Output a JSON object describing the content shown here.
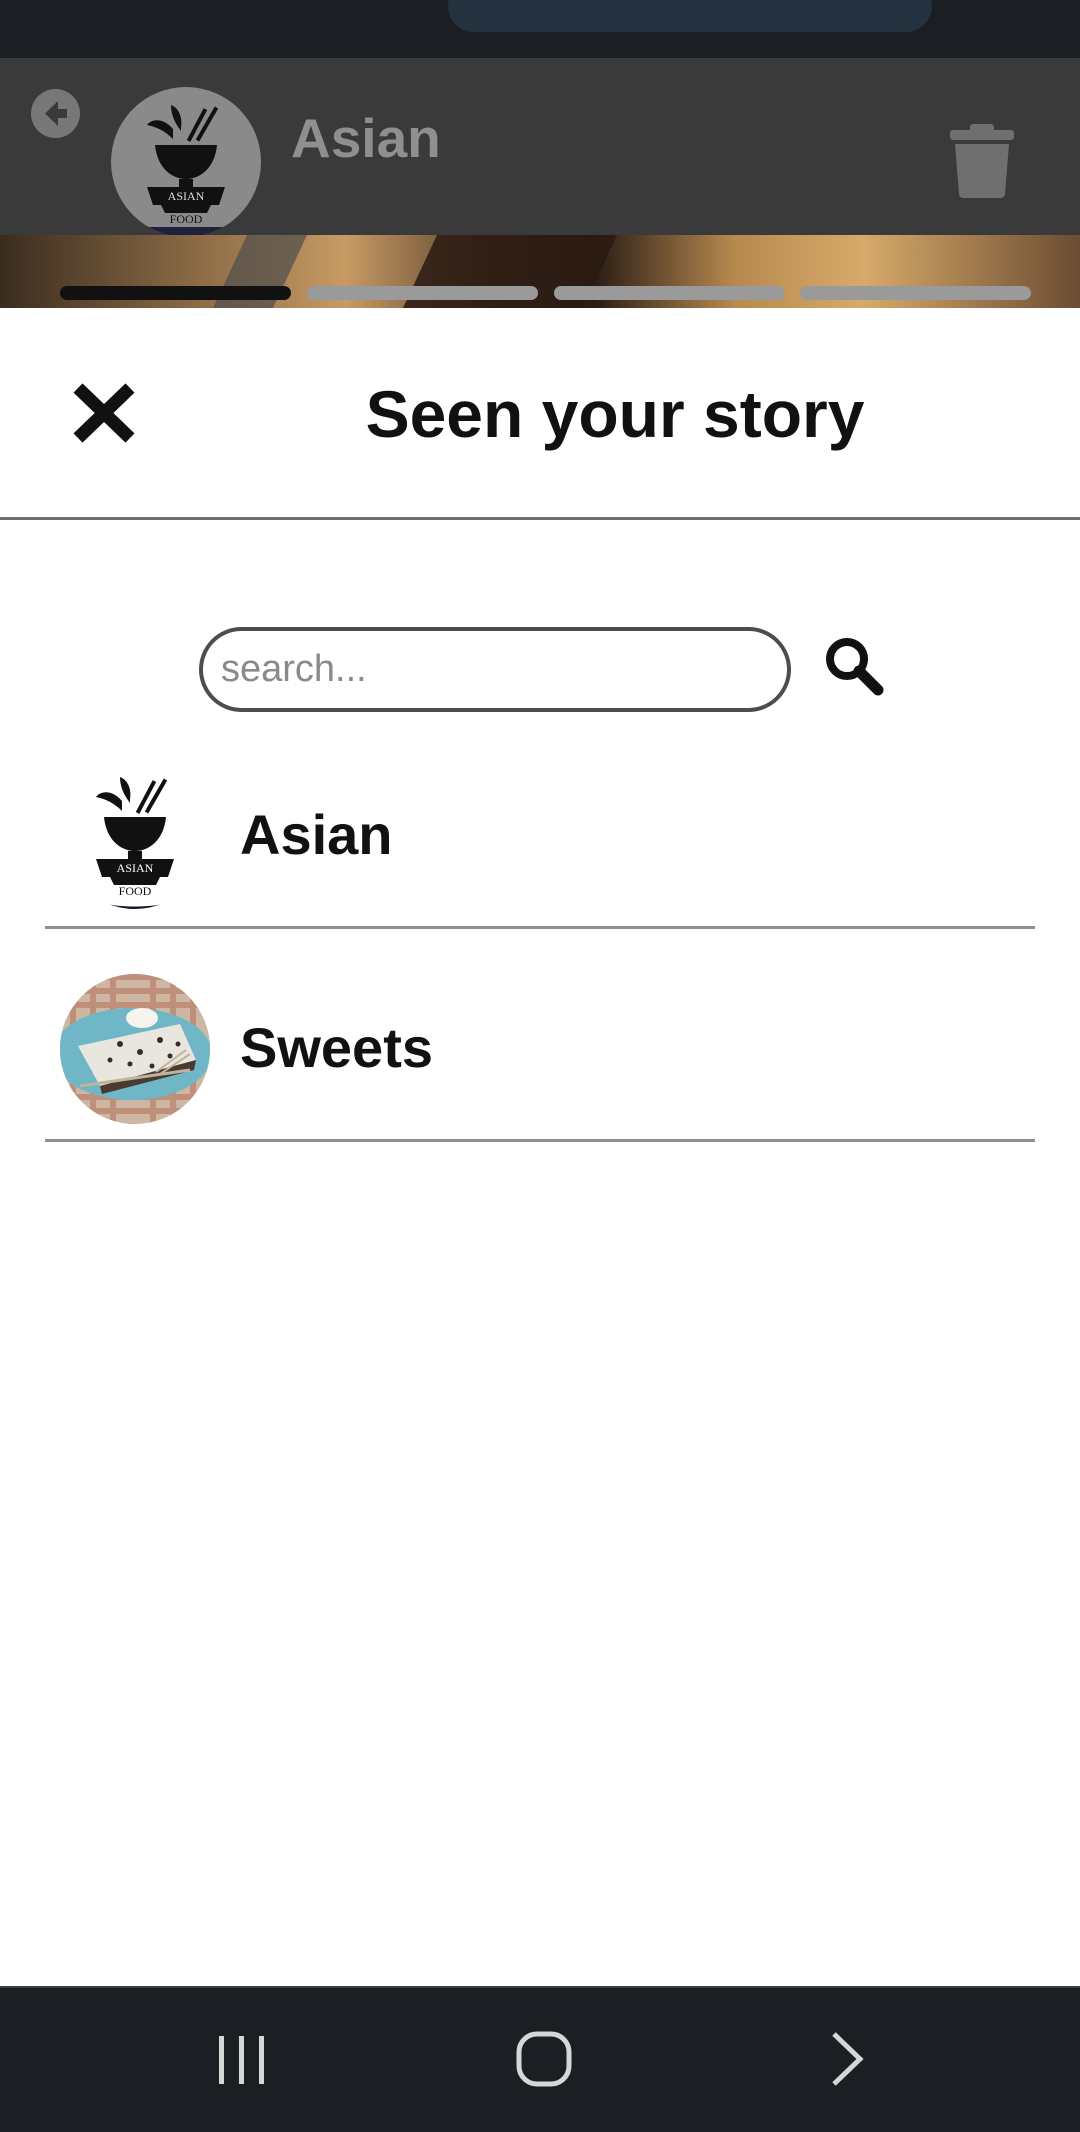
{
  "story": {
    "title": "Asian",
    "avatar_icon": "asian-food-logo-icon",
    "progress": [
      1,
      0,
      0,
      0
    ]
  },
  "sheet": {
    "title": "Seen your story"
  },
  "search": {
    "placeholder": "search...",
    "value": ""
  },
  "viewers": [
    {
      "name": "Asian",
      "avatar_icon": "asian-food-logo-icon"
    },
    {
      "name": "Sweets",
      "avatar_icon": "pie-photo-avatar"
    }
  ],
  "logo_text": {
    "line1": "ASIAN",
    "line2": "FOOD"
  },
  "icons": {
    "back": "arrow-left-icon",
    "delete": "trash-icon",
    "close": "close-icon",
    "search": "search-icon",
    "nav_recents": "recents-icon",
    "nav_home": "home-icon",
    "nav_back": "chevron-right-icon"
  },
  "colors": {
    "bar_background": "#1b1f24",
    "header_overlay": "#3a3a3a",
    "title_text": "#111111",
    "divider": "#8e8e8e"
  }
}
